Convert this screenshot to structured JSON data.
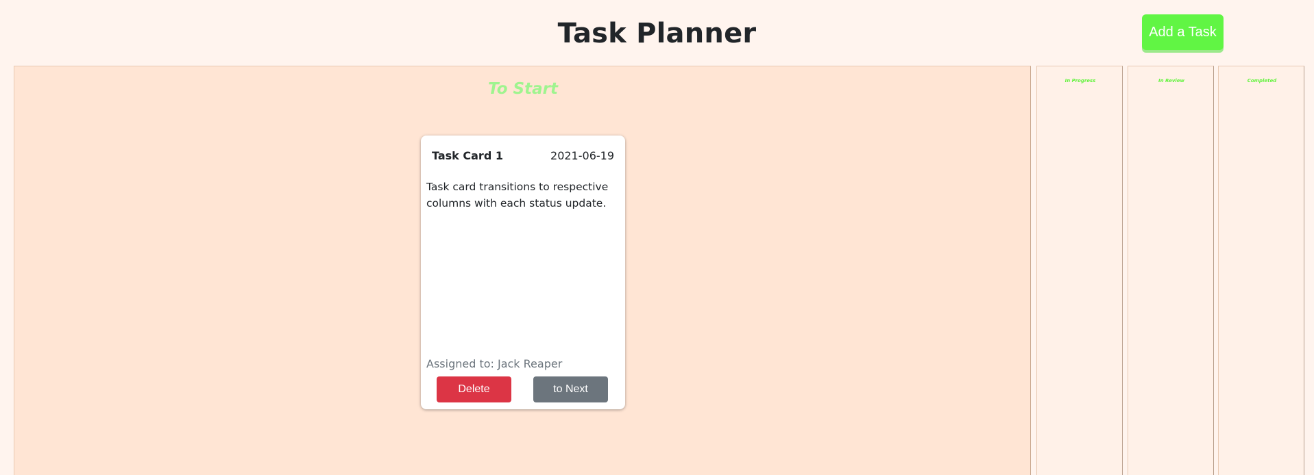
{
  "header": {
    "title": "Task Planner",
    "add_task_label": "Add a Task"
  },
  "columns": [
    {
      "title": "To Start"
    },
    {
      "title": "In Progress"
    },
    {
      "title": "In Review"
    },
    {
      "title": "Completed"
    }
  ],
  "cards": [
    {
      "title": "Task Card 1",
      "date": "2021-06-19",
      "description": "Task card transitions to respective columns with each status update.",
      "assignee": "Assigned to: Jack Reaper",
      "delete_label": "Delete",
      "next_label": "to Next"
    }
  ],
  "colors": {
    "accent_green": "#61f544",
    "delete_red": "#dc3545",
    "next_gray": "#6c757d",
    "todo_column_bg": "#ffe5d4",
    "page_bg": "#fff4ee"
  }
}
